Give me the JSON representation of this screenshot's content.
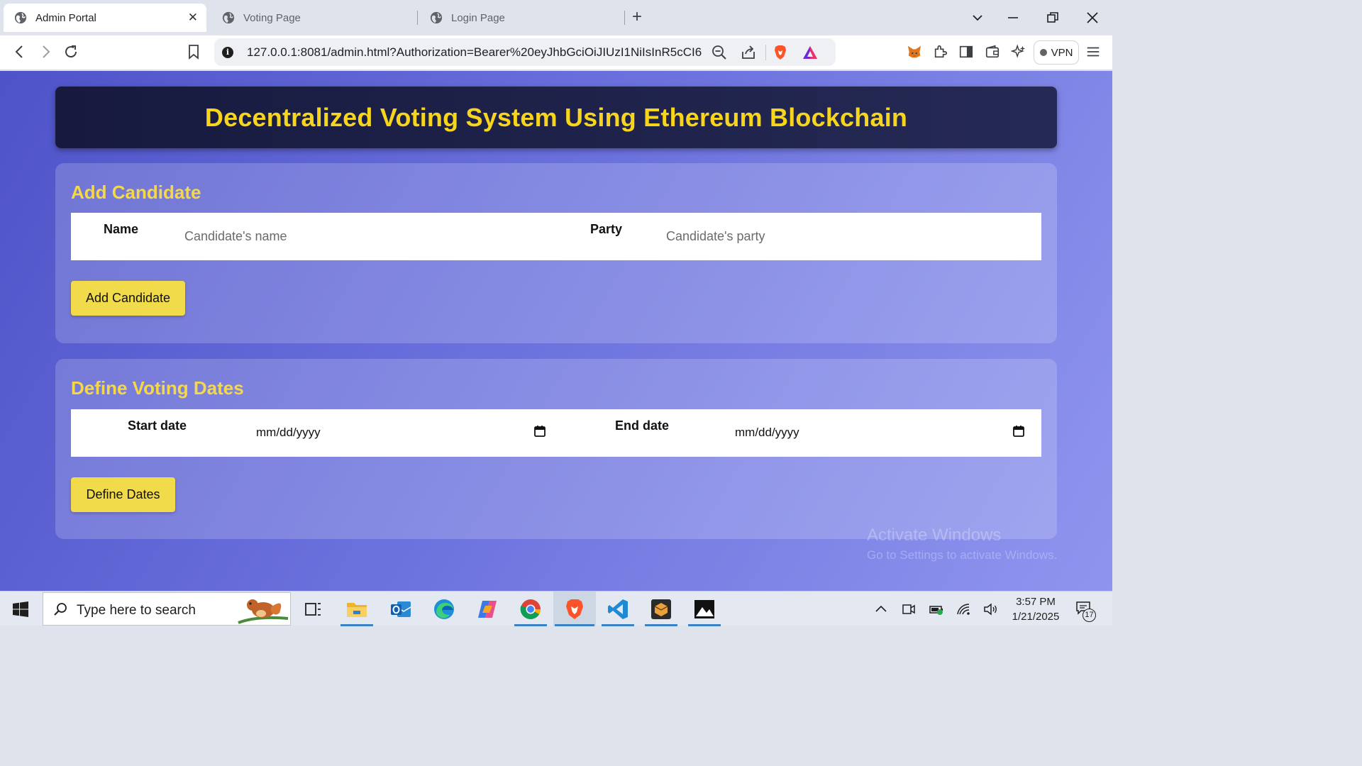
{
  "browser": {
    "tabs": [
      {
        "label": "Admin Portal",
        "active": true,
        "close_glyph": "✕"
      },
      {
        "label": "Voting Page",
        "active": false
      },
      {
        "label": "Login Page",
        "active": false
      }
    ],
    "new_tab_glyph": "+",
    "address_bar": {
      "url": "127.0.0.1:8081/admin.html?Authorization=Bearer%20eyJhbGciOiJIUzI1NiIsInR5cCI6..."
    },
    "vpn_label": "VPN"
  },
  "page": {
    "title": "Decentralized Voting System Using Ethereum Blockchain",
    "add_candidate": {
      "heading": "Add Candidate",
      "name_label": "Name",
      "name_placeholder": "Candidate's name",
      "party_label": "Party",
      "party_placeholder": "Candidate's party",
      "button_label": "Add Candidate"
    },
    "voting_dates": {
      "heading": "Define Voting Dates",
      "start_label": "Start date",
      "start_value": "mm/dd/yyyy",
      "end_label": "End date",
      "end_value": "mm/dd/yyyy",
      "button_label": "Define Dates"
    },
    "watermark": {
      "line1": "Activate Windows",
      "line2": "Go to Settings to activate Windows."
    }
  },
  "taskbar": {
    "search_placeholder": "Type here to search",
    "time": "3:57 PM",
    "date": "1/21/2025",
    "notification_count": "17"
  },
  "colors": {
    "title_yellow": "#f7d51d",
    "heading_yellow": "#f5d84a",
    "button_yellow": "#f1db4b",
    "header_navy": "#171a3e",
    "page_gradient_start": "#4e53c8",
    "page_gradient_end": "#8f95ee"
  }
}
